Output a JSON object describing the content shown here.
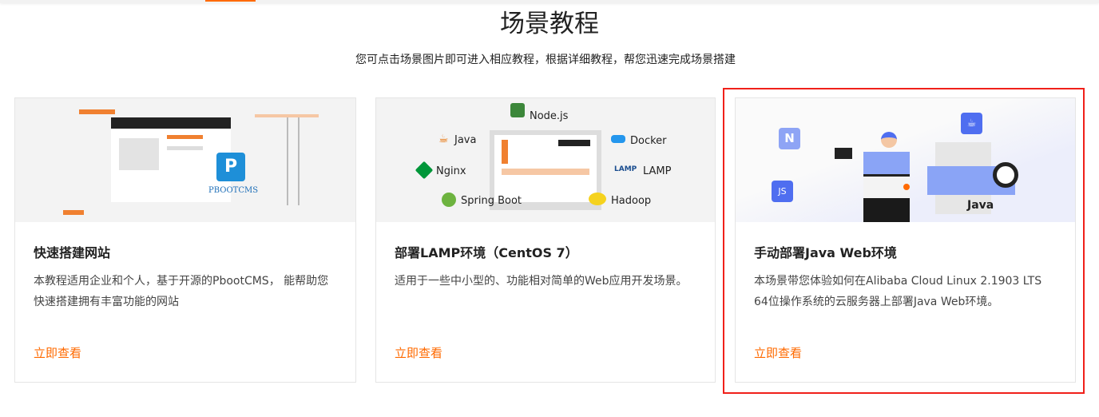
{
  "nav": {
    "active_indicator_color": "#ff6a00"
  },
  "header": {
    "title": "场景教程",
    "subtitle": "您可点击场景图片即可进入相应教程，根据详细教程，帮您迅速完成场景搭建"
  },
  "cards": [
    {
      "title": "快速搭建网站",
      "desc": "本教程适用企业和个人，基于开源的PbootCMS， 能帮助您快速搭建拥有丰富功能的网站",
      "link": "立即查看",
      "image_labels": {
        "logo": "PBOOTCMS"
      }
    },
    {
      "title": "部署LAMP环境（CentOS 7）",
      "desc": "适用于一些中小型的、功能相对简单的Web应用开发场景。",
      "link": "立即查看",
      "image_labels": {
        "node": "Node.js",
        "java": "Java",
        "docker": "Docker",
        "nginx": "Nginx",
        "lamp": "LAMP",
        "spring": "Spring Boot",
        "hadoop": "Hadoop"
      }
    },
    {
      "title": "手动部署Java Web环境",
      "desc": "本场景带您体验如何在Alibaba Cloud Linux 2.1903 LTS 64位操作系统的云服务器上部署Java Web环境。",
      "link": "立即查看",
      "image_labels": {
        "java": "Java"
      },
      "highlighted": true
    }
  ],
  "colors": {
    "accent": "#ff6a00",
    "highlight": "#f0201a"
  }
}
